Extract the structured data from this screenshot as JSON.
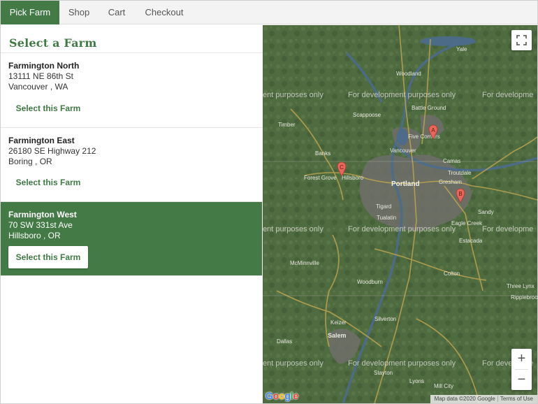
{
  "nav": {
    "items": [
      {
        "label": "Pick Farm",
        "active": true
      },
      {
        "label": "Shop",
        "active": false
      },
      {
        "label": "Cart",
        "active": false
      },
      {
        "label": "Checkout",
        "active": false
      }
    ]
  },
  "panel": {
    "title": "Select a Farm",
    "farms": [
      {
        "name": "Farmington North",
        "street": "13111 NE 86th St",
        "city": "Vancouver , WA",
        "button": "Select this Farm",
        "selected": false
      },
      {
        "name": "Farmington East",
        "street": "26180 SE Highway 212",
        "city": "Boring , OR",
        "button": "Select this Farm",
        "selected": false
      },
      {
        "name": "Farmington West",
        "street": "70 SW 331st Ave",
        "city": "Hillsboro , OR",
        "button": "Select this Farm",
        "selected": true
      }
    ]
  },
  "map": {
    "watermark": "For development purposes only",
    "watermark_fragment_left": "ent purposes only",
    "watermark_fragment_right": "For developme",
    "cities": [
      "Yale",
      "Woodland",
      "Battle Ground",
      "Five Corners",
      "Scappoose",
      "Vancouver",
      "Camas",
      "Timber",
      "Banks",
      "Forest Grove",
      "Hillsboro",
      "Portland",
      "Troutdale",
      "Gresham",
      "Tigard",
      "Tualatin",
      "Sandy",
      "Eagle Creek",
      "Estacada",
      "McMinnville",
      "Woodburn",
      "Colton",
      "Three Lynx",
      "Ripplebrook",
      "Keizer",
      "Silverton",
      "Salem",
      "Dallas",
      "Stayton",
      "Lyons",
      "Mill City"
    ],
    "markers": [
      "A",
      "B",
      "C"
    ],
    "zoom_in": "+",
    "zoom_out": "−",
    "attribution": "Map data ©2020 Google",
    "terms": "Terms of Use",
    "logo": "Google",
    "colors": {
      "terrain": "#4f6b40",
      "road": "#b9a24f",
      "water": "#4a6a8a",
      "urban": "#6b6b6b",
      "marker": "#e8665a"
    }
  }
}
